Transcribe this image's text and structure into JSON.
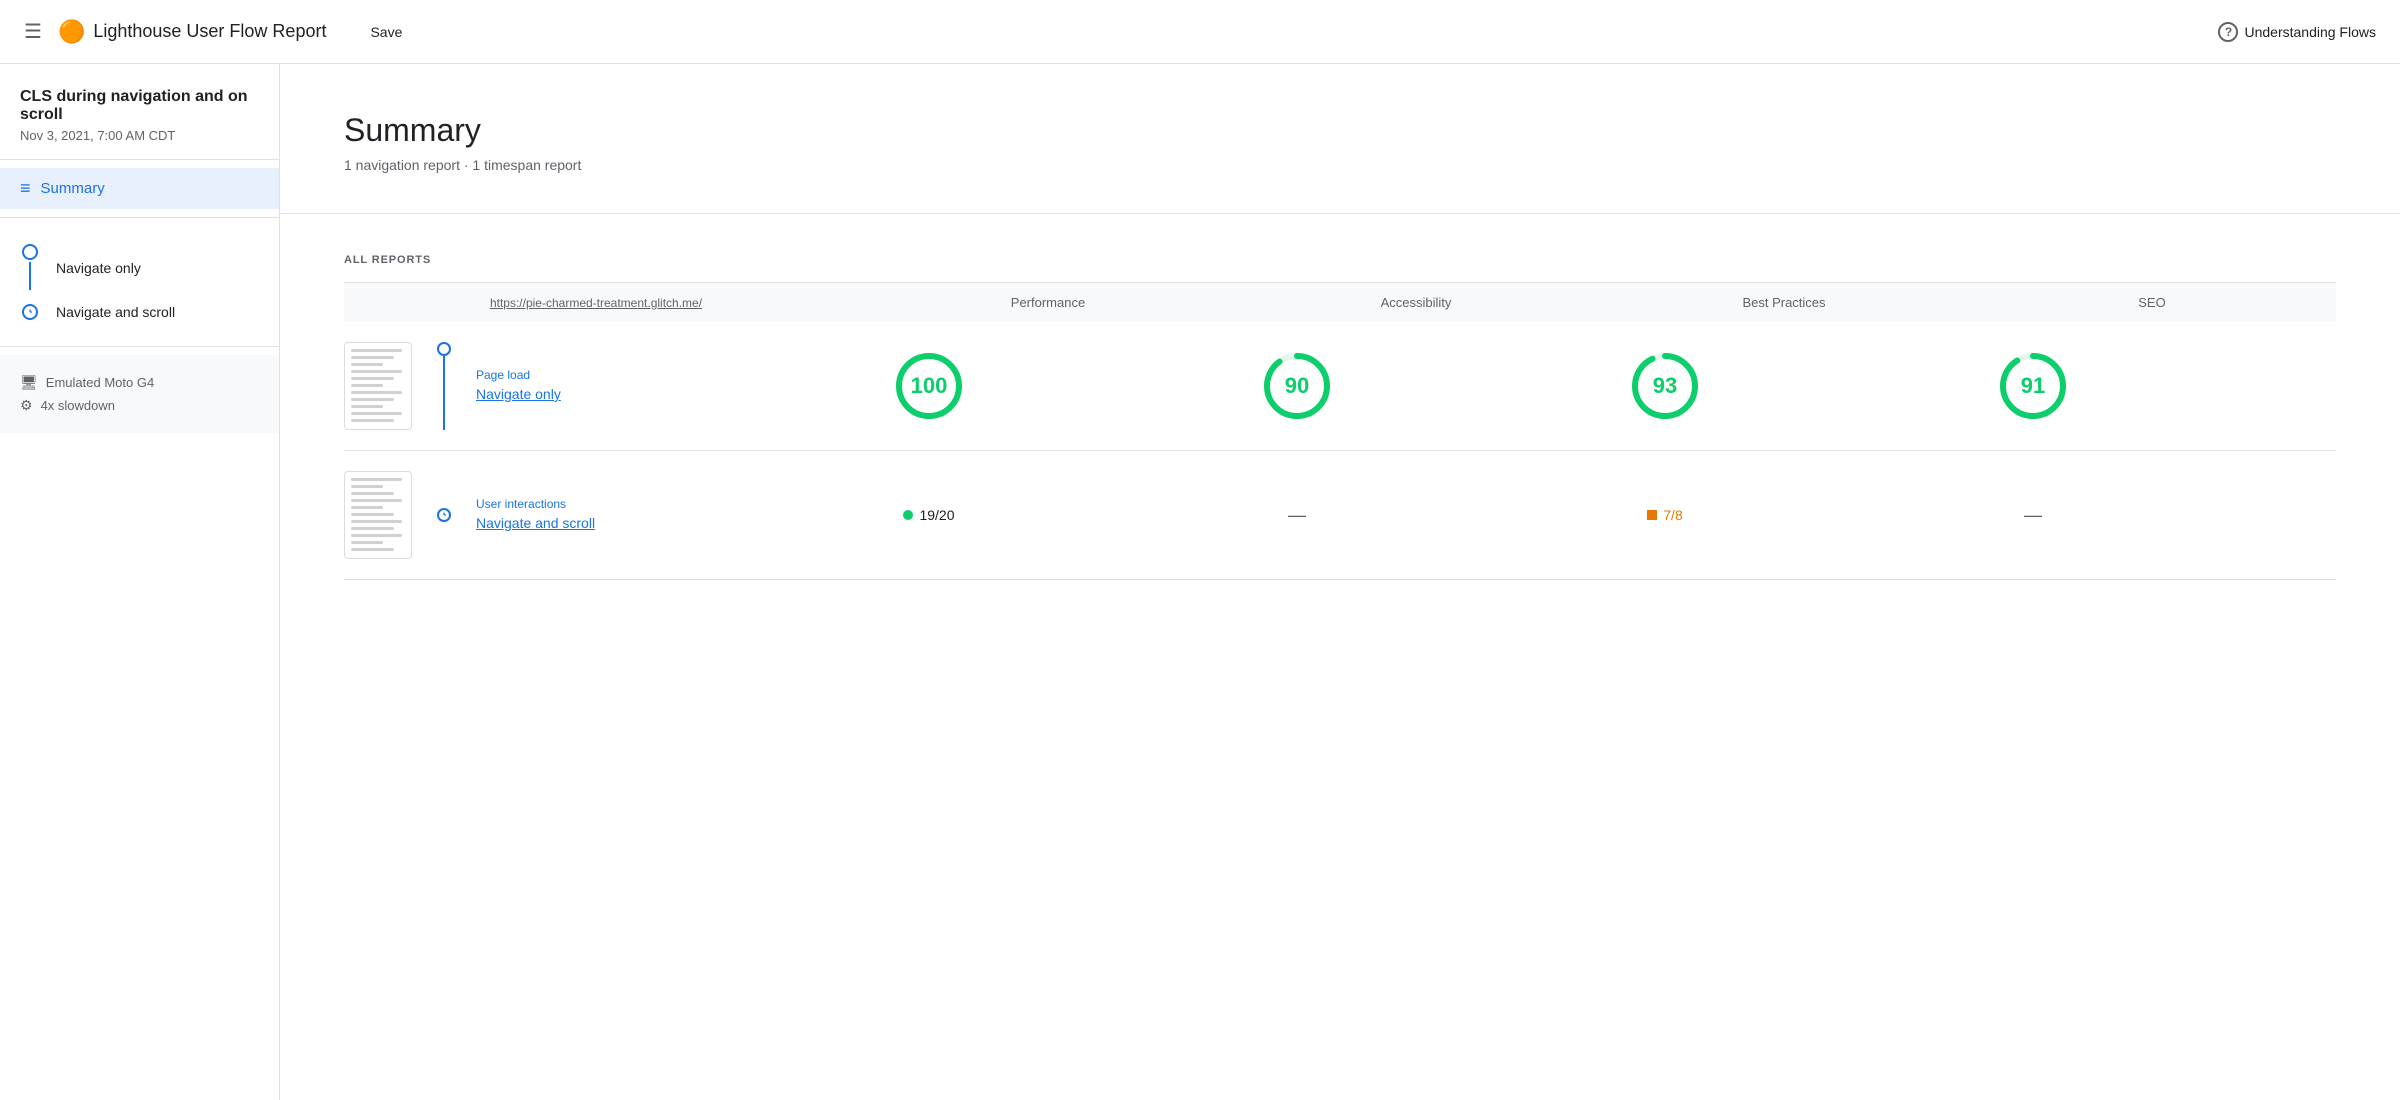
{
  "header": {
    "menu_label": "☰",
    "logo": "🟠",
    "title": "Lighthouse User Flow Report",
    "save_label": "Save",
    "help_icon": "?",
    "help_label": "Understanding Flows"
  },
  "sidebar": {
    "report_title": "CLS during navigation and on scroll",
    "report_date": "Nov 3, 2021, 7:00 AM CDT",
    "summary_label": "Summary",
    "nav_items": [
      {
        "label": "Navigate only",
        "type": "circle"
      },
      {
        "label": "Navigate and scroll",
        "type": "clock"
      }
    ],
    "device_items": [
      {
        "icon": "💻",
        "label": "Emulated Moto G4"
      },
      {
        "icon": "⚙",
        "label": "4x slowdown"
      }
    ]
  },
  "summary": {
    "heading": "Summary",
    "sub": "1 navigation report · 1 timespan report"
  },
  "reports": {
    "section_label": "ALL REPORTS",
    "url_header": "https://pie-charmed-treatment.glitch.me/",
    "col_headers": [
      "Performance",
      "Accessibility",
      "Best Practices",
      "SEO"
    ],
    "rows": [
      {
        "type_label": "Page load",
        "name": "Navigate only",
        "timeline_type": "circle",
        "scores": [
          {
            "kind": "circle",
            "value": 100,
            "color": "#0cce6b"
          },
          {
            "kind": "circle",
            "value": 90,
            "color": "#0cce6b"
          },
          {
            "kind": "circle",
            "value": 93,
            "color": "#0cce6b"
          },
          {
            "kind": "circle",
            "value": 91,
            "color": "#0cce6b"
          }
        ]
      },
      {
        "type_label": "User interactions",
        "name": "Navigate and scroll",
        "timeline_type": "clock",
        "scores": [
          {
            "kind": "dot",
            "value": "19/20",
            "color": "#0cce6b"
          },
          {
            "kind": "dash"
          },
          {
            "kind": "square",
            "value": "7/8",
            "color": "#e67700"
          },
          {
            "kind": "dash"
          }
        ]
      }
    ]
  }
}
